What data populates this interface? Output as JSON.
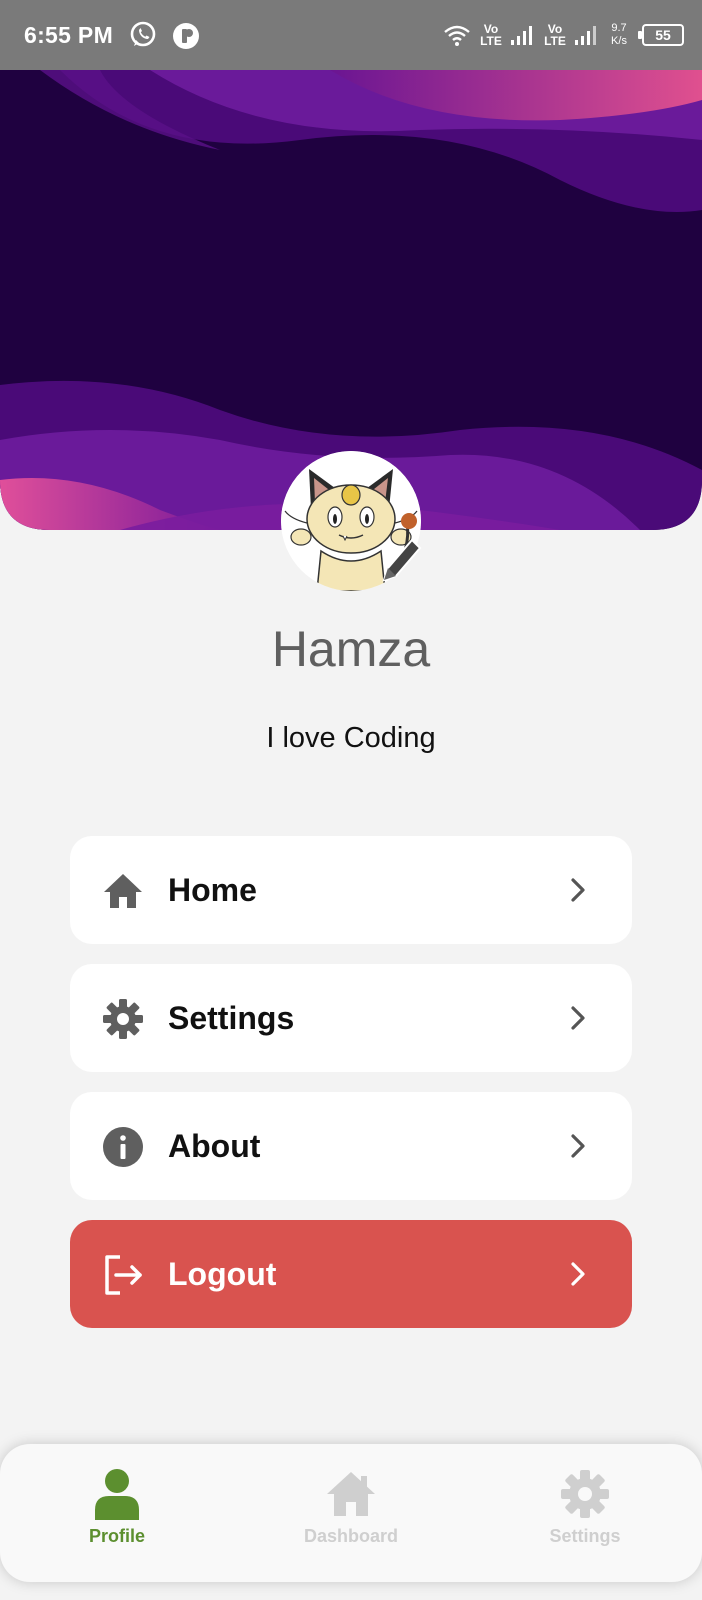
{
  "status_bar": {
    "time": "6:55 PM",
    "volte1": "Vo LTE",
    "volte2": "Vo LTE",
    "speed_value": "9.7",
    "speed_unit": "K/s",
    "battery": "55",
    "icons": [
      "whatsapp-icon",
      "pin-icon",
      "wifi-icon",
      "signal-icon",
      "battery-icon"
    ]
  },
  "profile": {
    "name": "Hamza",
    "bio": "I love Coding"
  },
  "menu": {
    "items": [
      {
        "label": "Home",
        "icon": "home-icon"
      },
      {
        "label": "Settings",
        "icon": "gear-icon"
      },
      {
        "label": "About",
        "icon": "info-icon"
      },
      {
        "label": "Logout",
        "icon": "logout-icon"
      }
    ]
  },
  "bottom_nav": {
    "items": [
      {
        "label": "Profile",
        "icon": "person-icon",
        "active": true
      },
      {
        "label": "Dashboard",
        "icon": "home-icon",
        "active": false
      },
      {
        "label": "Settings",
        "icon": "gear-icon",
        "active": false
      }
    ]
  },
  "colors": {
    "header_dark": "#1f0140",
    "header_purple": "#6a1a9a",
    "header_pink": "#e04f9a",
    "logout_bg": "#d9534f",
    "nav_active": "#5c8f2f",
    "nav_inactive": "#cfcfcf",
    "icon_gray": "#5f5f5f"
  }
}
